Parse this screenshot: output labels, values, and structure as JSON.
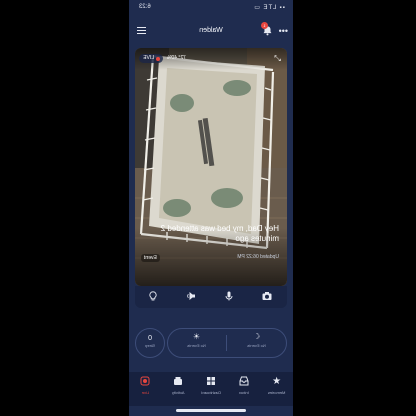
{
  "status_bar": {
    "time": "6:23",
    "icons": "▪▪ LTE ▭"
  },
  "header": {
    "title": "Walden",
    "notification_count": "1"
  },
  "camera": {
    "live_label": "LIVE",
    "room_stats": "72°  40%",
    "event_message": "Hey Dad, my bed was attended 2 minutes ago",
    "updated": "Updated 06:22 PM",
    "event_tag": "Event"
  },
  "controls": {
    "snapshot_icon": "camera-icon",
    "mic_icon": "microphone-icon",
    "speaker_icon": "speaker-icon",
    "light_icon": "lightbulb-icon"
  },
  "stats": {
    "count_value": "0",
    "count_unit": "Sleep",
    "left_label": "No Events",
    "right_label": "No Events"
  },
  "nav": {
    "items": [
      {
        "label": "Live",
        "icon": "camera-icon",
        "active": true
      },
      {
        "label": "Activity",
        "icon": "activity-icon",
        "active": false
      },
      {
        "label": "Dashboard",
        "icon": "dashboard-icon",
        "active": false
      },
      {
        "label": "Inbox",
        "icon": "inbox-icon",
        "active": false
      },
      {
        "label": "Memories",
        "icon": "star-icon",
        "active": false
      }
    ]
  },
  "colors": {
    "background": "#1f2c4f",
    "accent": "#e8463f",
    "nav_bg": "#17213f"
  }
}
